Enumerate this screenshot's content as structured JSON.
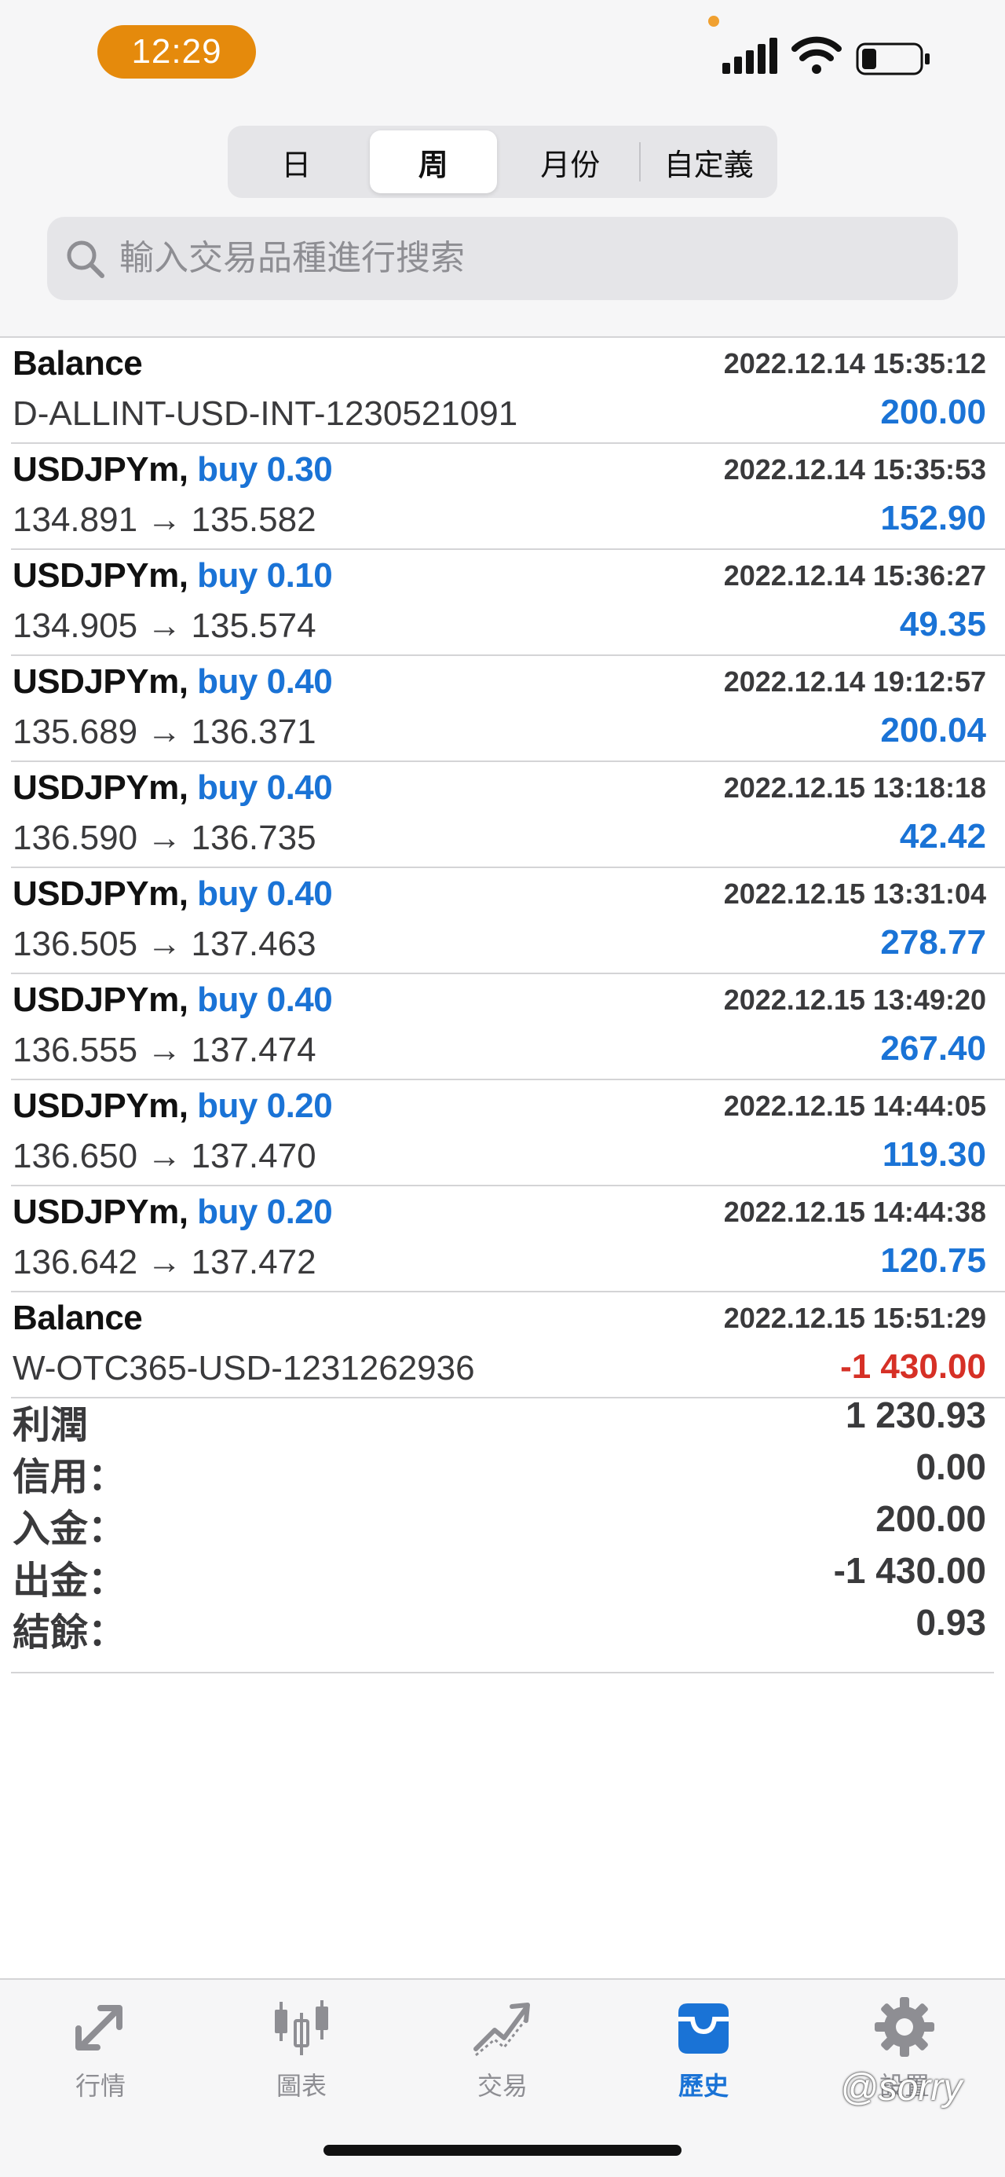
{
  "status_bar": {
    "time": "12:29"
  },
  "segments": [
    {
      "label": "日",
      "active": false
    },
    {
      "label": "周",
      "active": true
    },
    {
      "label": "月份",
      "active": false
    },
    {
      "label": "自定義",
      "active": false
    }
  ],
  "search": {
    "placeholder": "輸入交易品種進行搜索"
  },
  "rows": [
    {
      "title": "Balance",
      "buy": "",
      "date": "2022.12.14 15:35:12",
      "sub": "D-ALLINT-USD-INT-1230521091",
      "amount": "200.00"
    },
    {
      "title": "USDJPYm,",
      "buy": "buy 0.30",
      "date": "2022.12.14 15:35:53",
      "sub": "134.891 → 135.582",
      "amount": "152.90"
    },
    {
      "title": "USDJPYm,",
      "buy": "buy 0.10",
      "date": "2022.12.14 15:36:27",
      "sub": "134.905 → 135.574",
      "amount": "49.35"
    },
    {
      "title": "USDJPYm,",
      "buy": "buy 0.40",
      "date": "2022.12.14 19:12:57",
      "sub": "135.689 → 136.371",
      "amount": "200.04"
    },
    {
      "title": "USDJPYm,",
      "buy": "buy 0.40",
      "date": "2022.12.15 13:18:18",
      "sub": "136.590 → 136.735",
      "amount": "42.42"
    },
    {
      "title": "USDJPYm,",
      "buy": "buy 0.40",
      "date": "2022.12.15 13:31:04",
      "sub": "136.505 → 137.463",
      "amount": "278.77"
    },
    {
      "title": "USDJPYm,",
      "buy": "buy 0.40",
      "date": "2022.12.15 13:49:20",
      "sub": "136.555 → 137.474",
      "amount": "267.40"
    },
    {
      "title": "USDJPYm,",
      "buy": "buy 0.20",
      "date": "2022.12.15 14:44:05",
      "sub": "136.650 → 137.470",
      "amount": "119.30"
    },
    {
      "title": "USDJPYm,",
      "buy": "buy 0.20",
      "date": "2022.12.15 14:44:38",
      "sub": "136.642 → 137.472",
      "amount": "120.75"
    },
    {
      "title": "Balance",
      "buy": "",
      "date": "2022.12.15 15:51:29",
      "sub": "W-OTC365-USD-1231262936",
      "amount": "-1 430.00"
    }
  ],
  "summary": {
    "profit": {
      "label": "利潤",
      "value": "1 230.93"
    },
    "credit": {
      "label": "信用：",
      "value": "0.00"
    },
    "deposit": {
      "label": "入金：",
      "value": "200.00"
    },
    "withdrawal": {
      "label": "出金：",
      "value": "-1 430.00"
    },
    "balance": {
      "label": "結餘：",
      "value": "0.93"
    }
  },
  "tabs": [
    {
      "label": "行情",
      "icon": "quotes-arrows-icon",
      "active": false
    },
    {
      "label": "圖表",
      "icon": "candlestick-chart-icon",
      "active": false
    },
    {
      "label": "交易",
      "icon": "trade-trend-icon",
      "active": false
    },
    {
      "label": "歷史",
      "icon": "history-inbox-icon",
      "active": true
    },
    {
      "label": "設置",
      "icon": "gear-icon",
      "active": false
    }
  ],
  "watermark": "@sorry",
  "colors": {
    "accent": "#1a73d6",
    "negative": "#d63026",
    "time_pill": "#e58a0c"
  }
}
